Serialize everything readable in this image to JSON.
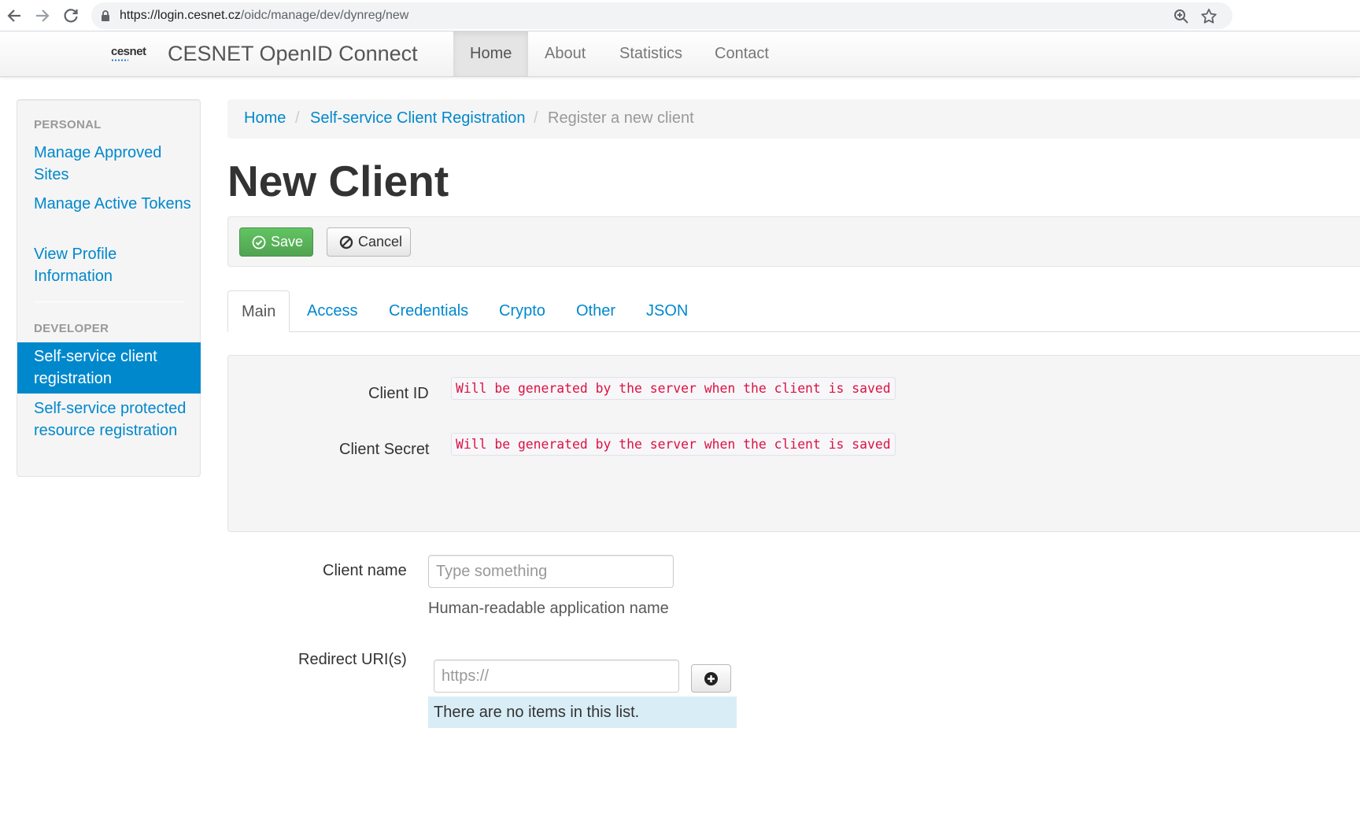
{
  "browser": {
    "url_host": "https://login.cesnet.cz",
    "url_path": "/oidc/manage/dev/dynreg/new"
  },
  "navbar": {
    "logo_text": "cesnet",
    "brand": "CESNET OpenID Connect",
    "items": [
      {
        "label": "Home",
        "active": true
      },
      {
        "label": "About"
      },
      {
        "label": "Statistics"
      },
      {
        "label": "Contact"
      }
    ]
  },
  "sidebar": {
    "personal_header": "PERSONAL",
    "personal_links": [
      "Manage Approved Sites",
      "Manage Active Tokens",
      "View Profile Information"
    ],
    "developer_header": "DEVELOPER",
    "active_link": "Self-service client registration",
    "developer_links": [
      "Self-service protected resource registration"
    ]
  },
  "breadcrumb": {
    "items": [
      "Home",
      "Self-service Client Registration"
    ],
    "separator": "/",
    "current": "Register a new client"
  },
  "page_title": "New Client",
  "actions": {
    "save_label": "Save",
    "cancel_label": "Cancel"
  },
  "tabs": [
    "Main",
    "Access",
    "Credentials",
    "Crypto",
    "Other",
    "JSON"
  ],
  "generated": {
    "client_id_label": "Client ID",
    "client_id_value": "Will be generated by the server when the client is saved",
    "client_secret_label": "Client Secret",
    "client_secret_value": "Will be generated by the server when the client is saved"
  },
  "form": {
    "client_name_label": "Client name",
    "client_name_placeholder": "Type something",
    "client_name_help": "Human-readable application name",
    "redirect_label": "Redirect URI(s)",
    "redirect_placeholder": "https://",
    "redirect_empty": "There are no items in this list."
  },
  "colors": {
    "link": "#0088cc",
    "active_sidebar": "#0088cc",
    "save_button": "#5bb75b",
    "code_text": "#dd1144",
    "info_bg": "#d9edf7"
  }
}
